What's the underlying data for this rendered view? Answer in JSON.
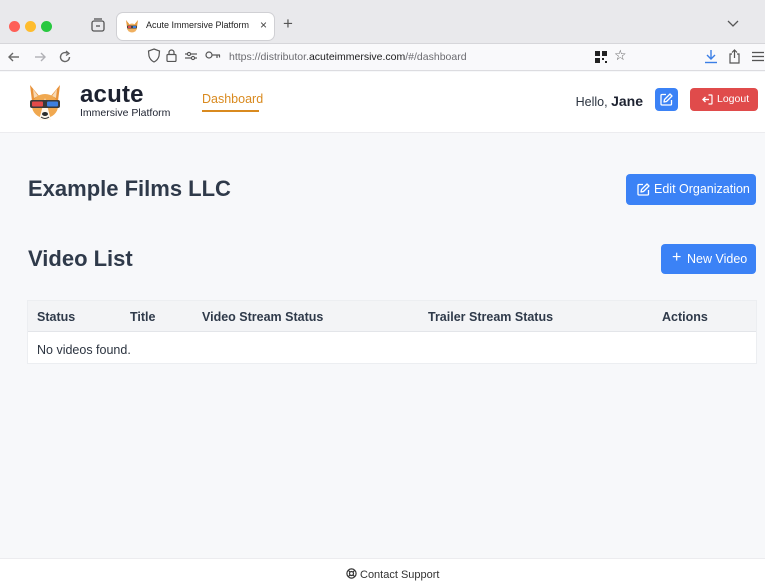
{
  "browser": {
    "tab_title": "Acute Immersive Platform",
    "tab_close": "×",
    "new_tab": "+",
    "url_prefix": "https://distributor.",
    "url_domain": "acuteimmersive.com",
    "url_suffix": "/#/dashboard"
  },
  "header": {
    "brand_name": "acute",
    "brand_sub": "Immersive Platform",
    "nav_dashboard": "Dashboard",
    "hello_prefix": "Hello, ",
    "user_name": "Jane",
    "logout_label": "Logout"
  },
  "organization": {
    "name": "Example Films LLC",
    "edit_label": "Edit Organization"
  },
  "videos": {
    "title": "Video List",
    "new_label": "New Video",
    "new_icon": "+",
    "columns": [
      "Status",
      "Title",
      "Video Stream Status",
      "Trailer Stream Status",
      "Actions"
    ],
    "empty_message": "No videos found."
  },
  "footer": {
    "support_label": "Contact Support"
  },
  "colors": {
    "accent_orange": "#d98a1f",
    "primary_blue": "#3b82f6",
    "danger_red": "#e04b4b"
  },
  "icons": [
    "tabs-icon",
    "chevron-down-icon",
    "back-icon",
    "forward-icon",
    "reload-icon",
    "shield-icon",
    "lock-icon",
    "permissions-icon",
    "key-icon",
    "qr-code-icon",
    "star-icon",
    "download-icon",
    "share-icon",
    "menu-icon",
    "edit-icon",
    "logout-icon",
    "plus-icon",
    "lifebuoy-icon"
  ]
}
